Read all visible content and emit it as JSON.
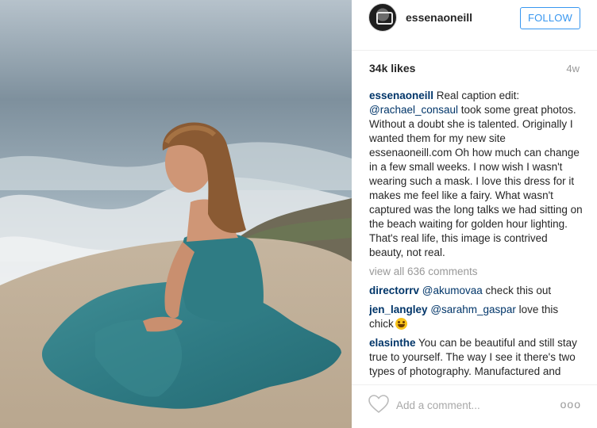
{
  "post": {
    "username": "essenaoneill",
    "follow_label": "FOLLOW",
    "likes": "34k likes",
    "age": "4w"
  },
  "caption": {
    "user": "essenaoneill",
    "text_1": " Real caption edit: ",
    "mention": "@rachael_consaul",
    "text_2": " took some great photos. Without a doubt she is talented. Originally I wanted them for my new site essenaoneill.com  Oh how much can change in a few small weeks. I now wish I wasn't wearing such a mask. I love this dress for it makes me feel like a fairy. What wasn't captured was the long talks we had sitting on the beach waiting for golden hour lighting. That's real life, this image is contrived beauty, not real."
  },
  "view_all_comments": "view all 636 comments",
  "comments": [
    {
      "user": "directorrv",
      "mention": "@akumovaa",
      "text": " check this out"
    },
    {
      "user": "jen_langley",
      "mention": "@sarahm_gaspar",
      "text": " love this chick"
    },
    {
      "user": "elasinthe",
      "text": " You can be beautiful and still stay true to yourself. The way I see it there's two types of photography. Manufactured and capturing real life. They both serve a purpose. But don't let it define who you are."
    }
  ],
  "footer": {
    "add_comment_placeholder": "Add a comment...",
    "more_label": "ooo"
  },
  "icons": {
    "like": "heart-icon",
    "emoji": "grinning-face-emoji",
    "more": "more-options-icon"
  },
  "colors": {
    "follow_blue": "#3897f0",
    "username_blue": "#003569",
    "muted_gray": "#999999"
  }
}
